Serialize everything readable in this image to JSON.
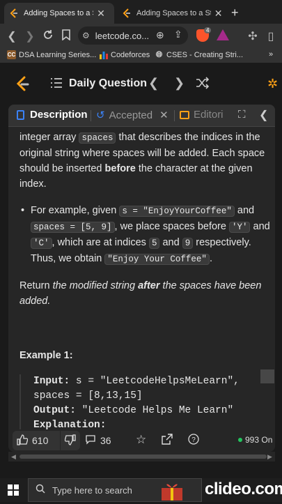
{
  "browser": {
    "tabs": [
      {
        "title": "Adding Spaces to a String",
        "active": true
      },
      {
        "title": "Adding Spaces to a String",
        "active": false
      }
    ],
    "url": "leetcode.co...",
    "brave_badge": "4",
    "bookmarks": [
      {
        "label": "DSA Learning Series...",
        "icon": "cc"
      },
      {
        "label": "Codeforces",
        "icon": "codeforces-icon"
      },
      {
        "label": "CSES - Creating Stri...",
        "icon": "globe-icon"
      }
    ],
    "bookmarks_more": "»"
  },
  "lc_header": {
    "title": "Daily Question"
  },
  "panel": {
    "tabs": {
      "description": "Description",
      "accepted": "Accepted",
      "editorial": "Editori"
    },
    "paragraph1": {
      "a": "integer array ",
      "code": "spaces",
      "b": " that describes the indices in the original string where spaces will be added. Each space should be inserted ",
      "bold": "before",
      "c": " the character at the given index."
    },
    "bullet": {
      "a": "For example, given ",
      "code1": "s = \"EnjoyYourCoffee\"",
      "b": " and ",
      "code2": "spaces = [5, 9]",
      "c": ", we place spaces before ",
      "code3": "'Y'",
      "d": " and ",
      "code4": "'C'",
      "e": ", which are at indices ",
      "code5": "5",
      "f": " and ",
      "code6": "9",
      "g": " respectively. Thus, we obtain ",
      "code7": "\"Enjoy Your Coffee\"",
      "h": "."
    },
    "paragraph2": {
      "a": "Return ",
      "italic1": "the modified string ",
      "bolditalic": "after",
      "italic2": " the spaces have been added."
    },
    "example": {
      "heading": "Example 1:",
      "input_label": "Input:",
      "input_value": " s = \"LeetcodeHelpsMeLearn\",",
      "input_value2": "spaces = [8,13,15]",
      "output_label": "Output:",
      "output_value": " \"Leetcode Helps Me Learn\"",
      "explanation_label": "Explanation:"
    },
    "bottom": {
      "likes": "610",
      "comments": "36",
      "online": "993 On"
    }
  },
  "taskbar": {
    "search_placeholder": "Type here to search",
    "watermark": "clideo.com"
  },
  "colors": {
    "accent_blue": "#3b82f6",
    "online_green": "#22c55e",
    "leetcode_orange": "#ffa116"
  }
}
